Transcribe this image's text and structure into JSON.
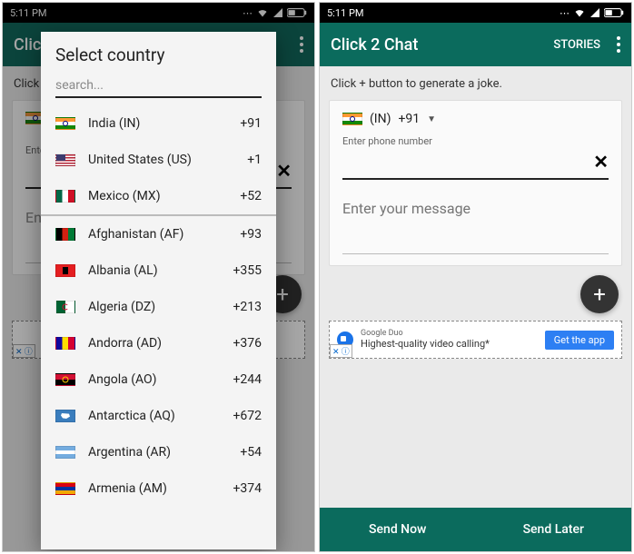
{
  "statusbar": {
    "time": "5:11 PM"
  },
  "appbar": {
    "title": "Click 2 Chat",
    "title_truncated": "Clic",
    "stories": "STORIES"
  },
  "hint": "Click + button to generate a joke.",
  "country": {
    "iso": "(IN)",
    "dial": "+91"
  },
  "phone": {
    "label": "Enter phone number",
    "placeholder_short": "Ent",
    "placeholder_trunc": "Ente"
  },
  "message": {
    "placeholder": "Enter your message",
    "placeholder_trunc": "Ent"
  },
  "ad": {
    "brand": "Google Duo",
    "text": "Highest-quality video calling*",
    "cta": "Get the app",
    "close": "✕",
    "info": "ⓘ"
  },
  "bottombar": {
    "now": "Send Now",
    "later": "Send Later"
  },
  "modal": {
    "title": "Select country",
    "search_placeholder": "search...",
    "recent": [
      {
        "name": "India (IN)",
        "code": "+91",
        "flag": "flag-in"
      },
      {
        "name": "United States (US)",
        "code": "+1",
        "flag": "flag-us"
      },
      {
        "name": "Mexico (MX)",
        "code": "+52",
        "flag": "flag-mx"
      }
    ],
    "all": [
      {
        "name": "Afghanistan (AF)",
        "code": "+93",
        "flag": "flag-af"
      },
      {
        "name": "Albania (AL)",
        "code": "+355",
        "flag": "flag-al"
      },
      {
        "name": "Algeria (DZ)",
        "code": "+213",
        "flag": "flag-dz"
      },
      {
        "name": "Andorra (AD)",
        "code": "+376",
        "flag": "flag-ad"
      },
      {
        "name": "Angola (AO)",
        "code": "+244",
        "flag": "flag-ao"
      },
      {
        "name": "Antarctica (AQ)",
        "code": "+672",
        "flag": "flag-aq"
      },
      {
        "name": "Argentina (AR)",
        "code": "+54",
        "flag": "flag-ar"
      },
      {
        "name": "Armenia (AM)",
        "code": "+374",
        "flag": "flag-am"
      }
    ]
  }
}
